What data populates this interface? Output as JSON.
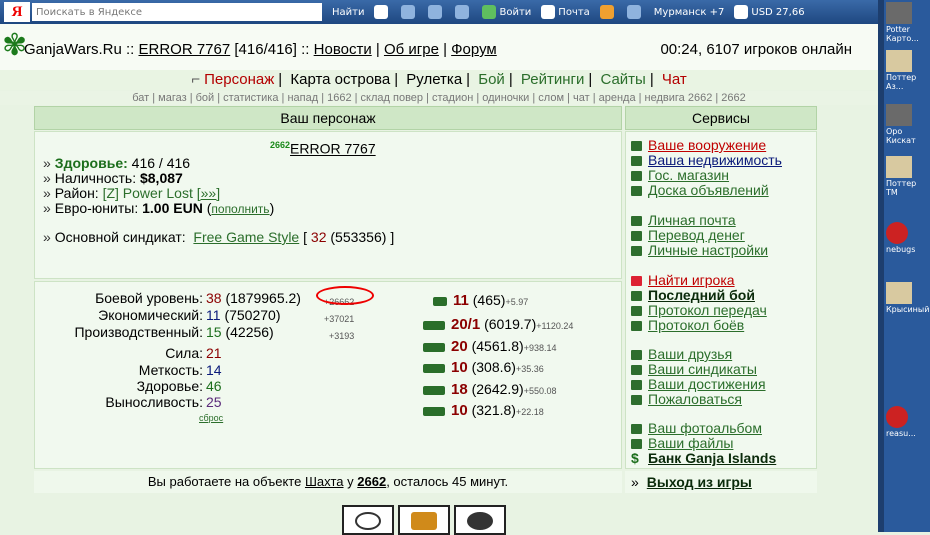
{
  "toolbar": {
    "yandex_letter": "Я",
    "search_placeholder": "Поискать в Яндексе",
    "find_label": "Найти",
    "login_label": "Войти",
    "mail_label": "Почта",
    "city_label": "Мурманск",
    "temp_label": "+7",
    "currency_label": "USD 27,66"
  },
  "sidebar_thumbs": [
    "Potter Карто...",
    "Поттер Аз...",
    "Оро Кискат",
    "Поттер ТМ",
    "nebugs",
    "Крысиный",
    "reasu..."
  ],
  "header": {
    "site": "GanjaWars.Ru",
    "sep1": "::",
    "player": "ERROR 7767",
    "hp": "[416/416]",
    "sep2": "::",
    "news": "Новости",
    "about": "Об игре",
    "forum": "Форум",
    "status": "00:24, 6107 игроков онлайн"
  },
  "mainnav": [
    "Персонаж",
    "Карта острова",
    "Рулетка",
    "Бой",
    "Рейтинги",
    "Сайты",
    "Чат"
  ],
  "subnav": "бат | магаз | бой | статистика | напад | 1662 | склад повер | стадион | одиночки | слом | чат | аренда | недвига 2662 | 2662",
  "character": {
    "panel_title": "Ваш персонаж",
    "sup": "2662",
    "name": "ERROR 7767",
    "health_label": "Здоровье:",
    "health_value": "416 / 416",
    "cash_label": "Наличность:",
    "cash_value": "$8,087",
    "district_label": "Район:",
    "district_value": "[Z] Power Lost",
    "district_more": "[»»]",
    "euro_label": "Евро-юниты:",
    "euro_value": "1.00 EUN",
    "euro_link": "пополнить",
    "syndicate_label": "Основной синдикат:",
    "syndicate_name": "Free Game Style",
    "syndicate_bracket_open": "[",
    "syndicate_num": "32",
    "syndicate_points": "(553356)",
    "syndicate_bracket_close": "]",
    "levels": [
      {
        "label": "Боевой уровень:",
        "value": "38",
        "exp": "(1879965.2)",
        "delta": "+26662"
      },
      {
        "label": "Экономический:",
        "value": "11",
        "exp": "(750270)",
        "delta": "+37021"
      },
      {
        "label": "Производственный:",
        "value": "15",
        "exp": "(42256)",
        "delta": "+3193"
      }
    ],
    "attrs": [
      {
        "label": "Сила:",
        "value": "21"
      },
      {
        "label": "Меткость:",
        "value": "14"
      },
      {
        "label": "Здоровье:",
        "value": "46"
      },
      {
        "label": "Выносливость:",
        "value": "25"
      }
    ],
    "reset_label": "сброс",
    "weapons": [
      {
        "value": "11",
        "exp": "(465)",
        "delta": "+5.97"
      },
      {
        "value": "20/1",
        "exp": "(6019.7)",
        "delta": "+1120.24"
      },
      {
        "value": "20",
        "exp": "(4561.8)",
        "delta": "+938.14"
      },
      {
        "value": "10",
        "exp": "(308.6)",
        "delta": "+35.36"
      },
      {
        "value": "18",
        "exp": "(2642.9)",
        "delta": "+550.08"
      },
      {
        "value": "10",
        "exp": "(321.8)",
        "delta": "+22.18"
      }
    ],
    "work_text_1": "Вы работаете на объекте",
    "work_object": "Шахта",
    "work_text_2": "у",
    "work_num": "2662",
    "work_text_3": ", осталось 45 минут."
  },
  "services": {
    "title": "Сервисы",
    "items": [
      "Ваше вооружение",
      "Ваша недвижимость",
      "Гос. магазин",
      "Доска объявлений",
      "Личная почта",
      "Перевод денег",
      "Личные настройки",
      "Найти игрока",
      "Последний бой",
      "Протокол передач",
      "Протокол боёв",
      "Ваши друзья",
      "Ваши синдикаты",
      "Ваши достижения",
      "Пожаловаться",
      "Ваш фотоальбом",
      "Ваши файлы",
      "Банк Ganja Islands"
    ],
    "exit_prefix": "»",
    "exit_label": "Выход из игры"
  },
  "colors": {
    "accent_red": "#b30000",
    "link_green": "#2b6e2b",
    "panel_bg": "#f1f9ef"
  }
}
